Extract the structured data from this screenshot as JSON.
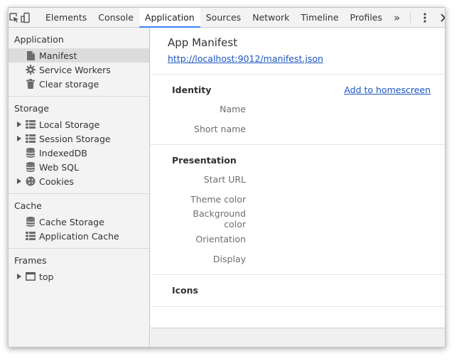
{
  "toolbar": {
    "tabs": [
      {
        "label": "Elements"
      },
      {
        "label": "Console"
      },
      {
        "label": "Application",
        "active": true
      },
      {
        "label": "Sources"
      },
      {
        "label": "Network"
      },
      {
        "label": "Timeline"
      },
      {
        "label": "Profiles"
      }
    ],
    "overflow_label": "»",
    "icons": [
      "inspect-element-icon",
      "device-toolbar-icon",
      "more-options-icon",
      "close-icon"
    ]
  },
  "sidebar": {
    "sections": [
      {
        "title": "Application",
        "items": [
          {
            "label": "Manifest",
            "icon": "document-icon",
            "selected": true
          },
          {
            "label": "Service Workers",
            "icon": "gear-icon"
          },
          {
            "label": "Clear storage",
            "icon": "trash-icon"
          }
        ]
      },
      {
        "title": "Storage",
        "items": [
          {
            "label": "Local Storage",
            "icon": "grid-icon",
            "expandable": true
          },
          {
            "label": "Session Storage",
            "icon": "grid-icon",
            "expandable": true
          },
          {
            "label": "IndexedDB",
            "icon": "database-icon"
          },
          {
            "label": "Web SQL",
            "icon": "database-icon"
          },
          {
            "label": "Cookies",
            "icon": "cookie-icon",
            "expandable": true
          }
        ]
      },
      {
        "title": "Cache",
        "items": [
          {
            "label": "Cache Storage",
            "icon": "database-icon"
          },
          {
            "label": "Application Cache",
            "icon": "grid-icon"
          }
        ]
      },
      {
        "title": "Frames",
        "items": [
          {
            "label": "top",
            "icon": "frame-icon",
            "expandable": true
          }
        ]
      }
    ]
  },
  "main": {
    "title": "App Manifest",
    "url": "http://localhost:9012/manifest.json",
    "identity": {
      "title": "Identity",
      "action": "Add to homescreen",
      "fields": [
        "Name",
        "Short name"
      ]
    },
    "presentation": {
      "title": "Presentation",
      "fields": [
        "Start URL",
        "Theme color",
        "Background color",
        "Orientation",
        "Display"
      ]
    },
    "icons_section": {
      "title": "Icons"
    }
  },
  "colors": {
    "accent": "#3e82f7",
    "link": "#1a55c2",
    "sidebar_bg": "#f3f3f3",
    "selected_bg": "#dcdcdc"
  }
}
